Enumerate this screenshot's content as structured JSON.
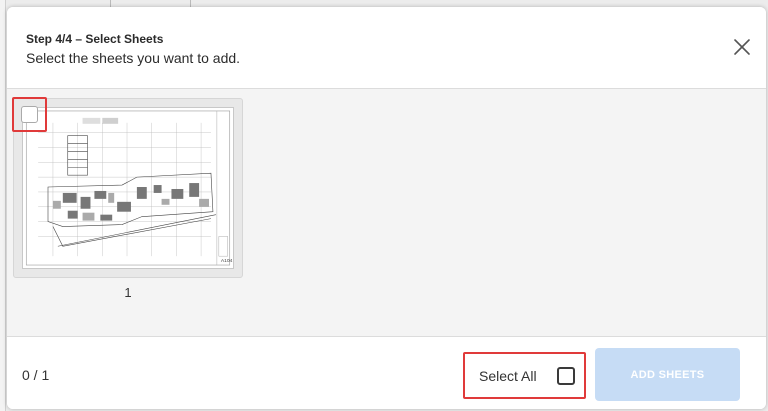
{
  "modal": {
    "step_title": "Step 4/4 – Select Sheets",
    "subtitle": "Select the sheets you want to add.",
    "close_icon": "close-icon"
  },
  "sheets": [
    {
      "label": "1",
      "sheet_number": "A104",
      "checked": false
    }
  ],
  "footer": {
    "counter": "0 / 1",
    "select_all_label": "Select All",
    "select_all_checked": false,
    "add_button_label": "ADD SHEETS",
    "add_button_enabled": false
  },
  "colors": {
    "highlight": "#e03a3a",
    "button_disabled": "#c6dcf5"
  }
}
